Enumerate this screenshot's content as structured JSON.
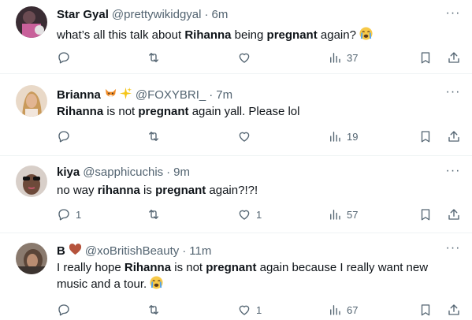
{
  "tweets": [
    {
      "name": "Star Gyal",
      "name_emoji": "",
      "handle": "@prettywikidgyal",
      "dot": "·",
      "time": "6m",
      "text_parts": [
        "what’s all this talk about ",
        "Rihanna",
        " being ",
        "pregnant",
        " again?"
      ],
      "reply_count": "",
      "retweet_count": "",
      "like_count": "",
      "view_count": "37"
    },
    {
      "name": "Brianna",
      "name_emoji": "fox-sparkles",
      "handle": "@FOXYBRI_",
      "dot": "·",
      "time": "7m",
      "text_parts": [
        "Rihanna",
        " is not ",
        "pregnant",
        " again yall. Please lol"
      ],
      "reply_count": "",
      "retweet_count": "",
      "like_count": "",
      "view_count": "19"
    },
    {
      "name": "kiya",
      "name_emoji": "",
      "handle": "@sapphicuchis",
      "dot": "·",
      "time": "9m",
      "text_parts": [
        "no way ",
        "rihanna",
        " is ",
        "pregnant",
        " again?!?!"
      ],
      "reply_count": "1",
      "retweet_count": "",
      "like_count": "1",
      "view_count": "57"
    },
    {
      "name": "B",
      "name_emoji": "heart",
      "handle": "@xoBritishBeauty",
      "dot": "·",
      "time": "11m",
      "text_parts": [
        "I really hope ",
        "Rihanna",
        " is not ",
        "pregnant",
        " again because I really want new music and a tour."
      ],
      "reply_count": "",
      "retweet_count": "",
      "like_count": "1",
      "view_count": "67"
    }
  ],
  "more_label": "···",
  "colors": {
    "text": "#0f1419",
    "muted": "#536471",
    "divider": "#eff3f4"
  }
}
